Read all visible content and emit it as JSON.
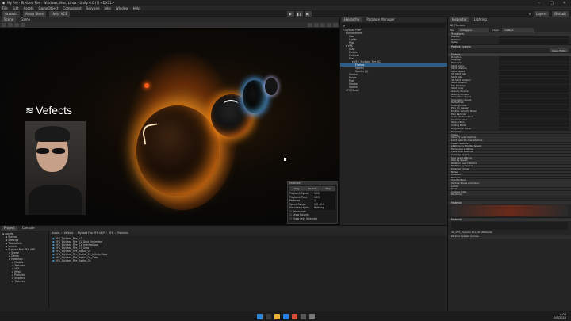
{
  "window": {
    "title": "My Pro - Stylized Fire - Windows, Mac, Linux - Unity 6.0 (?) <DX11>"
  },
  "menu": [
    "File",
    "Edit",
    "Assets",
    "GameObject",
    "Component",
    "Services",
    "Jobs",
    "Window",
    "Help"
  ],
  "toolbar": {
    "account": "Account",
    "store": "Asset Store",
    "version": "Unity VCS",
    "layers": "Layers",
    "layout": "Default"
  },
  "scene": {
    "tab_scene": "Scene",
    "tab_game": "Game"
  },
  "watermark": "Vefects",
  "particles_panel": {
    "title": "Particles",
    "buttons": [
      "Play",
      "Restart",
      "Stop"
    ],
    "rows": [
      {
        "label": "Playback Speed",
        "value": "1.00"
      },
      {
        "label": "Playback Time",
        "value": "1.23"
      },
      {
        "label": "Particles",
        "value": "1"
      },
      {
        "label": "Speed Range",
        "value": "0.0 - 0.0"
      },
      {
        "label": "Simulate Layers",
        "value": "Nothing"
      }
    ],
    "checks": [
      "Resimulate",
      "Show Bounds",
      "Show Only Selected"
    ]
  },
  "hierarchy": {
    "tab1": "Hierarchy",
    "tab2": "Package Manager",
    "rows": [
      {
        "t": "▾ Stylized Fire*",
        "d": 0,
        "sel": false
      },
      {
        "t": "Environment",
        "d": 1,
        "sel": false
      },
      {
        "t": "Gas",
        "d": 2,
        "sel": false
      },
      {
        "t": "Lights",
        "d": 2,
        "sel": false
      },
      {
        "t": "Post",
        "d": 2,
        "sel": false
      },
      {
        "t": "▾ VFX",
        "d": 1,
        "sel": false
      },
      {
        "t": "Dust",
        "d": 2,
        "sel": false
      },
      {
        "t": "Embers",
        "d": 2,
        "sel": false
      },
      {
        "t": "Embuds",
        "d": 2,
        "sel": false
      },
      {
        "t": "Fire",
        "d": 2,
        "sel": false
      },
      {
        "t": "▾ VFX_Stylized_Fire_01",
        "d": 3,
        "sel": false
      },
      {
        "t": "Flames",
        "d": 4,
        "sel": true
      },
      {
        "t": "Sparks",
        "d": 4,
        "sel": false
      },
      {
        "t": "Sparks (1)",
        "d": 4,
        "sel": false
      },
      {
        "t": "Smoke",
        "d": 2,
        "sel": false
      },
      {
        "t": "Mocie",
        "d": 2,
        "sel": false
      },
      {
        "t": "Post",
        "d": 2,
        "sel": false
      },
      {
        "t": "Smoke",
        "d": 2,
        "sel": false
      },
      {
        "t": "Sparks",
        "d": 2,
        "sel": false
      },
      {
        "t": "VFX Model",
        "d": 1,
        "sel": false
      }
    ]
  },
  "inspector": {
    "tab1": "Inspector",
    "tab2": "Lighting",
    "object_name": "Flames",
    "tag": "Untagged",
    "layer": "Default",
    "transform": {
      "title": "Transform",
      "rows": [
        "Position",
        "Rotation",
        "Scale"
      ]
    },
    "ps_title": "Particle System",
    "open_editor": "Open Editor",
    "ps_sub": "Flames",
    "ps_rows": [
      "Duration",
      "Looping",
      "Prewarm",
      "Start Delay",
      "Start Lifetime",
      "Start Speed",
      "3D Start Size",
      "Start Size",
      "3D Start Rotation",
      "Start Rotation",
      "Flip Rotation",
      "Start Color",
      "Gravity Source",
      "Gravity Modifier",
      "Simulation Space",
      "Simulation Speed",
      "Delta Time",
      "Scaling Mode",
      "Play On Awake*",
      "Emitter Velocity Mode",
      "Max Particles",
      "Auto Random Seed",
      "Random Seed",
      "Stop Action",
      "Culling Mode",
      "Ring Buffer Mode"
    ],
    "modules": [
      "Emission",
      "Shape",
      "Velocity over Lifetime",
      "Limit Velocity over Lifetime",
      "Inherit Velocity",
      "Lifetime by Emitter Speed",
      "Force over Lifetime",
      "Color over Lifetime",
      "Color by Speed",
      "Size over Lifetime",
      "Size by Speed",
      "Rotation over Lifetime",
      "Rotation by Speed",
      "External Forces",
      "Noise",
      "Collision",
      "Triggers",
      "Sub Emitters",
      "Texture Sheet Animation",
      "Lights",
      "Trails",
      "Custom Data",
      "Renderer"
    ],
    "section1": "Material",
    "section2": "Material",
    "bottom_label": "VA_VFX_Stylized_Fire_01 (Material)",
    "curves": "Particle System Curves"
  },
  "project": {
    "tab1": "Project",
    "tab2": "Console",
    "breadcrumb": [
      "Assets",
      "Vefects",
      "Stylized Fire VFX URP",
      "VFX",
      "Particles"
    ],
    "tree": [
      "Assets",
      "Scenes",
      "Settings",
      "TutorialInfo",
      "Vefects",
      "Stylized Fire VFX URP",
      "Scene",
      "Demo",
      "Materials",
      "Models",
      "Textures",
      "VFX",
      "Mesh",
      "Particles",
      "Shaders",
      "Textures"
    ],
    "files": [
      "VFX_Stylized_Fire_01",
      "VFX_Stylized_Fire_01_Dust_Unlimited",
      "VFX_Stylized_Fire_01_InfiniteGlow",
      "VFX_Stylized_Fire_01_Orbs",
      "VFX_Stylized_Fire_Radial_01",
      "VFX_Stylized_Fire_Radial_01_InfiniteGlow",
      "VFX_Stylized_Fire_Radial_01_Orbs",
      "VFX_Stylized_Fire_Radial_02"
    ]
  },
  "taskbar": {
    "time": "0:00",
    "date": "0/0/2024"
  }
}
